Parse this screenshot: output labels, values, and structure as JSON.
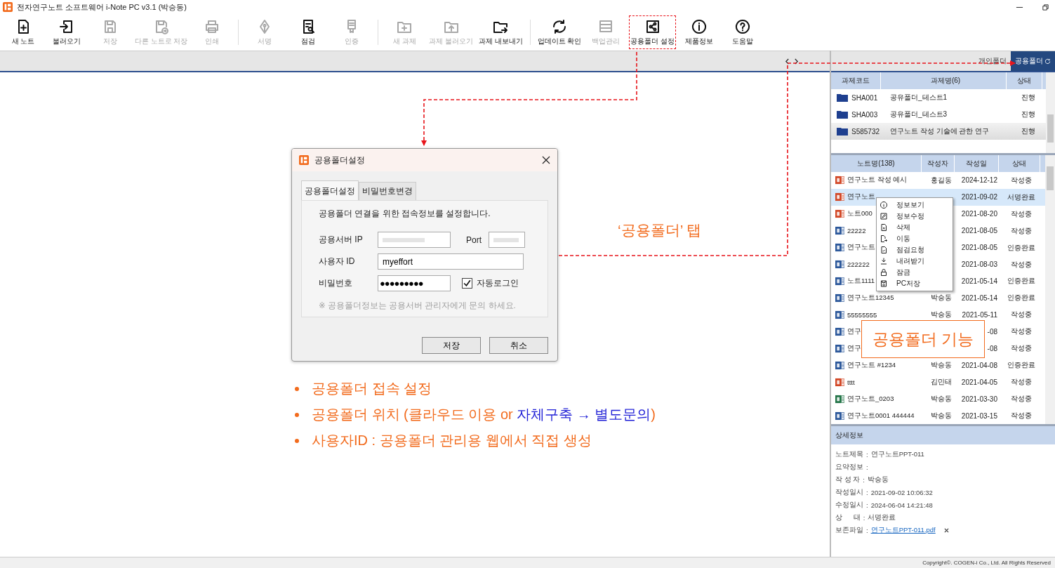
{
  "window": {
    "title": "전자연구노트 소프트웨어 i-Note PC v3.1 (박승동)"
  },
  "toolbar": [
    {
      "label": "새 노트",
      "kind": "new_note",
      "disabled": false,
      "separator_after": false,
      "highlighted": false
    },
    {
      "label": "불러오기",
      "kind": "import",
      "disabled": false,
      "separator_after": false,
      "highlighted": false
    },
    {
      "label": "저장",
      "kind": "save",
      "disabled": true,
      "separator_after": false,
      "highlighted": false
    },
    {
      "label": "다른 노트로 저장",
      "kind": "save_as",
      "disabled": true,
      "separator_after": false,
      "highlighted": false
    },
    {
      "label": "인쇄",
      "kind": "print",
      "disabled": true,
      "separator_after": true,
      "highlighted": false
    },
    {
      "label": "서명",
      "kind": "sign",
      "disabled": true,
      "separator_after": false,
      "highlighted": false
    },
    {
      "label": "점검",
      "kind": "inspect",
      "disabled": false,
      "separator_after": false,
      "highlighted": false
    },
    {
      "label": "인증",
      "kind": "certify",
      "disabled": true,
      "separator_after": true,
      "highlighted": false
    },
    {
      "label": "새 과제",
      "kind": "project_new",
      "disabled": true,
      "separator_after": false,
      "highlighted": false
    },
    {
      "label": "과제 불러오기",
      "kind": "project_import",
      "disabled": true,
      "separator_after": false,
      "highlighted": false
    },
    {
      "label": "과제 내보내기",
      "kind": "project_export",
      "disabled": false,
      "separator_after": true,
      "highlighted": false
    },
    {
      "label": "업데이트 확인",
      "kind": "update",
      "disabled": false,
      "separator_after": false,
      "highlighted": false
    },
    {
      "label": "백업관리",
      "kind": "backup",
      "disabled": true,
      "separator_after": false,
      "highlighted": false
    },
    {
      "label": "공용폴더 설정",
      "kind": "share",
      "disabled": false,
      "separator_after": false,
      "highlighted": true
    },
    {
      "label": "제품정보",
      "kind": "info",
      "disabled": false,
      "separator_after": false,
      "highlighted": false
    },
    {
      "label": "도움말",
      "kind": "help",
      "disabled": false,
      "separator_after": false,
      "highlighted": false
    }
  ],
  "folder_tabs": [
    {
      "label": "개인폴더",
      "selected": false
    },
    {
      "label": "공용폴더",
      "selected": true
    }
  ],
  "projects": {
    "columns": [
      "과제코드",
      "과제명(6)",
      "상태"
    ],
    "rows": [
      {
        "code": "SHA001",
        "name": "공유폴더_테스트1",
        "status": "진행",
        "selected": false
      },
      {
        "code": "SHA003",
        "name": "공유폴더_테스트3",
        "status": "진행",
        "selected": false
      },
      {
        "code": "S585732",
        "name": "연구노트 작성 기술에 관한 연구",
        "status": "진행",
        "selected": true
      }
    ]
  },
  "notes": {
    "columns": [
      "노트명(138)",
      "작성자",
      "작성일",
      "상태"
    ],
    "rows": [
      {
        "kind": "ppt",
        "name": "연구노트 작성 예시",
        "author": "홍길동",
        "date": "2024-12-12",
        "status": "작성중",
        "selected": false
      },
      {
        "kind": "ppt",
        "name": "연구노트",
        "date": "2021-09-02",
        "status": "서명완료",
        "selected": true
      },
      {
        "kind": "ppt",
        "name": "노트000",
        "date": "2021-08-20",
        "status": "작성중",
        "selected": false
      },
      {
        "kind": "word",
        "name": "22222",
        "date": "2021-08-05",
        "status": "작성중",
        "selected": false
      },
      {
        "kind": "word",
        "name": "연구노트",
        "date": "2021-08-05",
        "status": "인증완료",
        "selected": false
      },
      {
        "kind": "word",
        "name": "222222",
        "date": "2021-08-03",
        "status": "작성중",
        "selected": false
      },
      {
        "kind": "word",
        "name": "노트1111",
        "date": "2021-05-14",
        "status": "인증완료",
        "selected": false
      },
      {
        "kind": "word",
        "name": "연구노트12345",
        "author": "박승동",
        "date": "2021-05-14",
        "status": "인증완료",
        "selected": false
      },
      {
        "kind": "word",
        "name": "55555555",
        "author": "박승동",
        "date": "2021-05-11",
        "status": "작성중",
        "selected": false
      },
      {
        "kind": "word",
        "name": "연구",
        "date": "-08",
        "status": "작성중",
        "selected": false
      },
      {
        "kind": "word",
        "name": "연구",
        "date": "-08",
        "status": "작성중",
        "selected": false
      },
      {
        "kind": "word",
        "name": "연구노트 #1234",
        "author": "박승동",
        "date": "2021-04-08",
        "status": "인증완료",
        "selected": false
      },
      {
        "kind": "ppt",
        "name": "tttt",
        "author": "김민태",
        "date": "2021-04-05",
        "status": "작성중",
        "selected": false
      },
      {
        "kind": "excel",
        "name": "연구노트_0203",
        "author": "박승동",
        "date": "2021-03-30",
        "status": "작성중",
        "selected": false
      },
      {
        "kind": "word",
        "name": "연구노트0001 444444",
        "author": "박승동",
        "date": "2021-03-15",
        "status": "작성중",
        "selected": false
      }
    ]
  },
  "context_menu": [
    {
      "label": "정보보기",
      "kind": "info"
    },
    {
      "label": "정보수정",
      "kind": "edit"
    },
    {
      "label": "삭제",
      "kind": "delete"
    },
    {
      "label": "이동",
      "kind": "move"
    },
    {
      "label": "점검요청",
      "kind": "check"
    },
    {
      "label": "내려받기",
      "kind": "download"
    },
    {
      "label": "잠금",
      "kind": "lock"
    },
    {
      "label": "PC저장",
      "kind": "save"
    }
  ],
  "details": {
    "title": "상세정보",
    "rows": [
      {
        "label": "노트제목",
        "colon": ":",
        "value": "연구노트PPT-011"
      },
      {
        "label": "요약정보",
        "colon": ":"
      },
      {
        "label": "작 성 자",
        "colon": ":",
        "value": "박승동"
      },
      {
        "label": "작성일시",
        "colon": ":",
        "value": "2021-09-02 10:06:32"
      },
      {
        "label": "수정일시",
        "colon": ":",
        "value": "2024-06-04 14:21:48"
      },
      {
        "label": "상      태",
        "colon": ":",
        "value": "서명완료"
      },
      {
        "label": "보존파일",
        "colon": ":",
        "link": "연구노트PPT-011.pdf",
        "removable": true
      }
    ]
  },
  "status_bar": "Copyright©. COGEN-i Co., Ltd. All Rights Reserved",
  "dialog": {
    "title": "공용폴더설정",
    "tabs": [
      {
        "label": "공용폴더설정",
        "selected": true
      },
      {
        "label": "비밀번호변경",
        "selected": false
      }
    ],
    "description": "공용폴더 연결을 위한 접속정보를 설정합니다.",
    "server_label": "공용서버 IP",
    "port_label": "Port",
    "user_label": "사용자 ID",
    "user_value": "myeffort",
    "password_label": "비밀번호",
    "password_value": "●●●●●●●●●",
    "auto_login": {
      "label": "자동로그인",
      "checked": true
    },
    "note": "※ 공용폴더정보는 공용서버 관리자에게 문의 하세요.",
    "buttons": [
      "저장",
      "취소"
    ]
  },
  "annotations": {
    "tab_callout": "‘공용폴더’ 탭",
    "feature_callout": "공용폴더 기능",
    "bullets": [
      {
        "text": "공용폴더 접속 설정"
      },
      {
        "text": "공용폴더 위치 (클라우드 이용 or ",
        "highlight": "자체구축 → 별도문의",
        "suffix": ")"
      },
      {
        "text": "사용자ID : 공용폴더 관리용 웹에서 직접 생성"
      }
    ]
  }
}
